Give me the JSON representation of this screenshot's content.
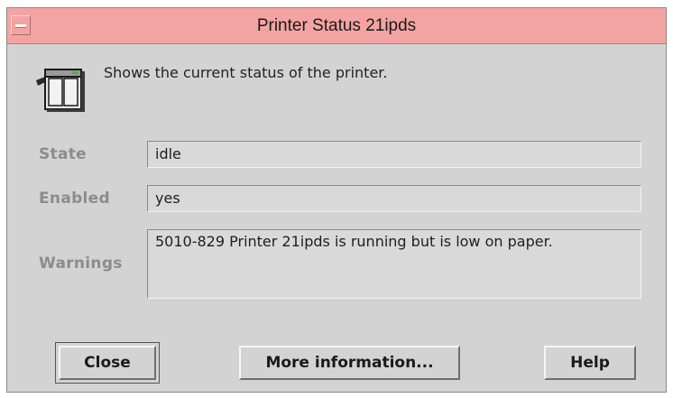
{
  "window": {
    "title": "Printer Status 21ipds"
  },
  "header": {
    "description": "Shows the current status of the printer."
  },
  "fields": {
    "state_label": "State",
    "state_value": "idle",
    "enabled_label": "Enabled",
    "enabled_value": "yes",
    "warnings_label": "Warnings",
    "warnings_value": "5010-829 Printer 21ipds is running but is low on paper."
  },
  "buttons": {
    "close": "Close",
    "more_info": "More information...",
    "help": "Help"
  },
  "icons": {
    "window_menu": "window-menu-icon",
    "printer": "printer-icon"
  },
  "colors": {
    "titlebar": "#f4a3a3",
    "window_bg": "#d3d3d3",
    "label": "#8c8c8c"
  }
}
